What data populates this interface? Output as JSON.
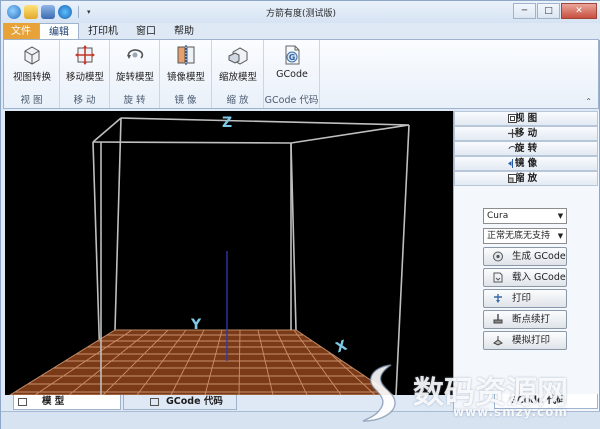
{
  "window": {
    "title": "方箭有度(测试版)",
    "controls": {
      "minimize": "─",
      "maximize": "□",
      "close": "✕"
    }
  },
  "menu": {
    "tabs": [
      "文件",
      "编辑",
      "打印机",
      "窗口",
      "帮助"
    ],
    "active": "编辑"
  },
  "ribbon": {
    "groups": [
      {
        "caption": "视 图",
        "button": "视图转换",
        "icon": "view-cube-icon"
      },
      {
        "caption": "移 动",
        "button": "移动模型",
        "icon": "move-arrows-icon"
      },
      {
        "caption": "旋 转",
        "button": "旋转模型",
        "icon": "rotate-icon"
      },
      {
        "caption": "镜 像",
        "button": "镜像模型",
        "icon": "mirror-icon"
      },
      {
        "caption": "缩 放",
        "button": "缩放模型",
        "icon": "scale-icon"
      },
      {
        "caption": "GCode 代码",
        "button": "GCode",
        "icon": "gcode-icon"
      }
    ],
    "collapse": "⌃"
  },
  "viewport": {
    "axis_x": "X",
    "axis_y": "Y",
    "axis_z": "Z",
    "bed_color": "#7a3a18",
    "grid_color": "#d9a07a",
    "box_color": "#bfbfbf"
  },
  "bottom_tabs": [
    {
      "label": "模 型",
      "icon": "model-icon"
    },
    {
      "label": "GCode 代码",
      "icon": "gcode-tab-icon"
    }
  ],
  "right_panel": {
    "sections": [
      {
        "label": "视 图",
        "icon": "view-icon"
      },
      {
        "label": "移 动",
        "icon": "move-icon"
      },
      {
        "label": "旋 转",
        "icon": "rotate-icon"
      },
      {
        "label": "镜 像",
        "icon": "mirror-icon"
      },
      {
        "label": "缩 放",
        "icon": "scale-icon"
      }
    ],
    "slicer_select": "Cura",
    "support_select": "正常无底无支持",
    "actions": [
      {
        "label": "生成 GCode",
        "icon": "generate-gcode-icon"
      },
      {
        "label": "载入 GCode",
        "icon": "load-gcode-icon"
      },
      {
        "label": "打印",
        "icon": "print-icon"
      },
      {
        "label": "断点续打",
        "icon": "resume-print-icon"
      },
      {
        "label": "模拟打印",
        "icon": "simulate-print-icon"
      }
    ],
    "partial_tab": "GCode 代码"
  },
  "watermark": {
    "text": "数码资源网",
    "url": "www.smzy.com"
  }
}
